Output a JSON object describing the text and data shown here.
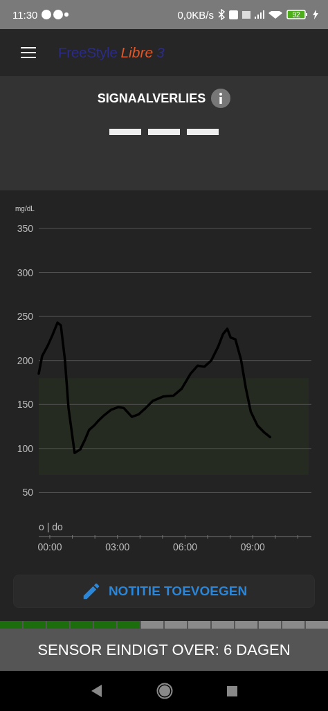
{
  "status_bar": {
    "time": "11:30",
    "net_speed": "0,0KB/s",
    "battery": "92"
  },
  "app_bar": {
    "logo": {
      "brand": "FreeStyle",
      "product": "Libre",
      "version": "3"
    }
  },
  "reading": {
    "title": "SIGNAALVERLIES"
  },
  "graph": {
    "day_label": "o | do",
    "chart_data": {
      "type": "line",
      "ylabel": "mg/dL",
      "xlim": [
        -0.49,
        11.6
      ],
      "ylim": [
        0,
        350
      ],
      "grid": true,
      "xticks": [
        {
          "value": 0,
          "label": "00:00"
        },
        {
          "value": 3,
          "label": "03:00"
        },
        {
          "value": 6,
          "label": "06:00"
        },
        {
          "value": 9,
          "label": "09:00"
        }
      ],
      "yticks": [
        50,
        100,
        150,
        200,
        250,
        300,
        350
      ],
      "bands": [
        {
          "axis": "y",
          "from": 70,
          "to": 180
        }
      ],
      "x": [
        -0.49,
        -0.34,
        -0.09,
        0.12,
        0.34,
        0.49,
        0.67,
        0.83,
        1.1,
        1.35,
        1.56,
        1.74,
        1.96,
        2.17,
        2.42,
        2.72,
        3.03,
        3.28,
        3.64,
        3.95,
        4.25,
        4.56,
        5.02,
        5.48,
        5.85,
        6.24,
        6.55,
        6.86,
        7.16,
        7.47,
        7.68,
        7.87,
        8.02,
        8.23,
        8.48,
        8.69,
        8.91,
        9.21,
        9.52,
        9.77
      ],
      "series": [
        {
          "color": "#000000",
          "values": [
            185,
            205,
            217,
            229,
            243,
            240,
            201,
            146,
            95,
            99,
            110,
            121,
            126,
            132,
            138,
            144,
            147,
            146,
            136,
            139,
            146,
            154,
            159,
            160,
            168,
            185,
            194,
            193,
            200,
            216,
            230,
            236,
            226,
            224,
            201,
            169,
            142,
            126,
            118,
            113
          ]
        }
      ]
    }
  },
  "note_button": {
    "label": "NOTITIE TOEVOEGEN"
  },
  "sensor": {
    "segments": [
      {
        "on": true
      },
      {
        "on": true
      },
      {
        "on": true
      },
      {
        "on": true
      },
      {
        "on": true
      },
      {
        "on": true
      },
      {
        "on": false
      },
      {
        "on": false
      },
      {
        "on": false
      },
      {
        "on": false
      },
      {
        "on": false
      },
      {
        "on": false
      },
      {
        "on": false
      },
      {
        "on": false
      }
    ],
    "message": "SENSOR EINDIGT OVER: 6 DAGEN"
  }
}
